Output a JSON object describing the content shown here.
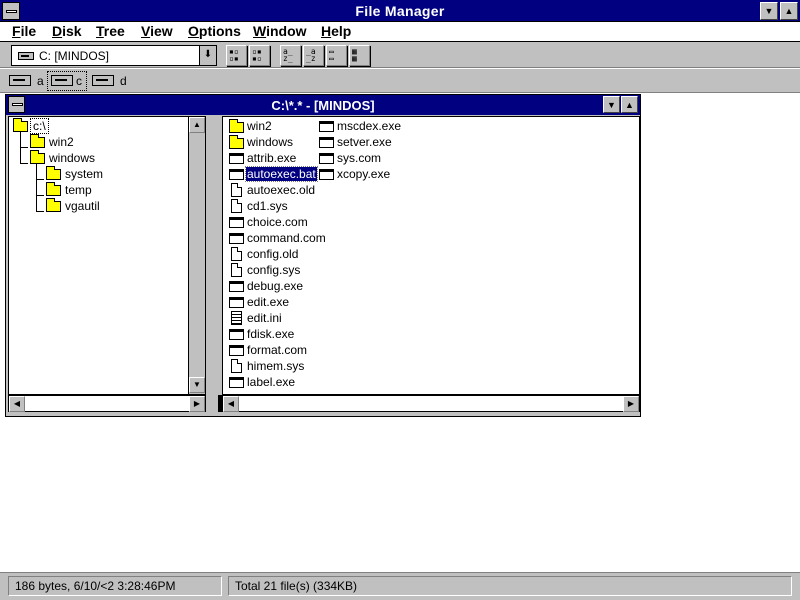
{
  "window": {
    "title": "File Manager"
  },
  "menu": [
    {
      "label": "File",
      "accel": "F",
      "rest": "ile"
    },
    {
      "label": "Disk",
      "accel": "D",
      "rest": "isk"
    },
    {
      "label": "Tree",
      "accel": "T",
      "rest": "ree"
    },
    {
      "label": "View",
      "accel": "V",
      "rest": "iew"
    },
    {
      "label": "Options",
      "accel": "O",
      "rest": "ptions"
    },
    {
      "label": "Window",
      "accel": "W",
      "rest": "indow"
    },
    {
      "label": "Help",
      "accel": "H",
      "rest": "elp"
    }
  ],
  "toolbar": {
    "drive_value": "C: [MINDOS]",
    "buttons": [
      "connect-net-drive-icon",
      "disconnect-net-drive-icon",
      "sort-by-name-icon",
      "sort-by-type-icon",
      "sort-by-size-icon",
      "sort-by-date-icon",
      "new-window-icon"
    ]
  },
  "drives": [
    {
      "letter": "a",
      "icon": "floppy-drive-icon",
      "selected": false
    },
    {
      "letter": "c",
      "icon": "hard-drive-icon",
      "selected": true
    },
    {
      "letter": "d",
      "icon": "cdrom-drive-icon",
      "selected": false
    }
  ],
  "child_window": {
    "title": "C:\\*.* - [MINDOS]"
  },
  "tree": [
    {
      "label": "c:\\",
      "level": 0,
      "open": true
    },
    {
      "label": "win2",
      "level": 1
    },
    {
      "label": "windows",
      "level": 1
    },
    {
      "label": "system",
      "level": 2
    },
    {
      "label": "temp",
      "level": 2
    },
    {
      "label": "vgautil",
      "level": 2
    }
  ],
  "files": {
    "col1": [
      {
        "name": "win2",
        "type": "folder"
      },
      {
        "name": "windows",
        "type": "folder"
      },
      {
        "name": "attrib.exe",
        "type": "exe"
      },
      {
        "name": "autoexec.bat",
        "type": "exe",
        "selected": true
      },
      {
        "name": "autoexec.old",
        "type": "doc"
      },
      {
        "name": "cd1.sys",
        "type": "doc"
      },
      {
        "name": "choice.com",
        "type": "exe"
      },
      {
        "name": "command.com",
        "type": "exe"
      },
      {
        "name": "config.old",
        "type": "doc"
      },
      {
        "name": "config.sys",
        "type": "doc"
      },
      {
        "name": "debug.exe",
        "type": "exe"
      },
      {
        "name": "edit.exe",
        "type": "exe"
      },
      {
        "name": "edit.ini",
        "type": "txt"
      },
      {
        "name": "fdisk.exe",
        "type": "exe"
      },
      {
        "name": "format.com",
        "type": "exe"
      },
      {
        "name": "himem.sys",
        "type": "doc"
      },
      {
        "name": "label.exe",
        "type": "exe"
      }
    ],
    "col2": [
      {
        "name": "mscdex.exe",
        "type": "exe"
      },
      {
        "name": "setver.exe",
        "type": "exe"
      },
      {
        "name": "sys.com",
        "type": "exe"
      },
      {
        "name": "xcopy.exe",
        "type": "exe"
      }
    ]
  },
  "status": {
    "left": "186 bytes, 6/10/<2 3:28:46PM",
    "right": "Total 21 file(s) (334KB)"
  }
}
